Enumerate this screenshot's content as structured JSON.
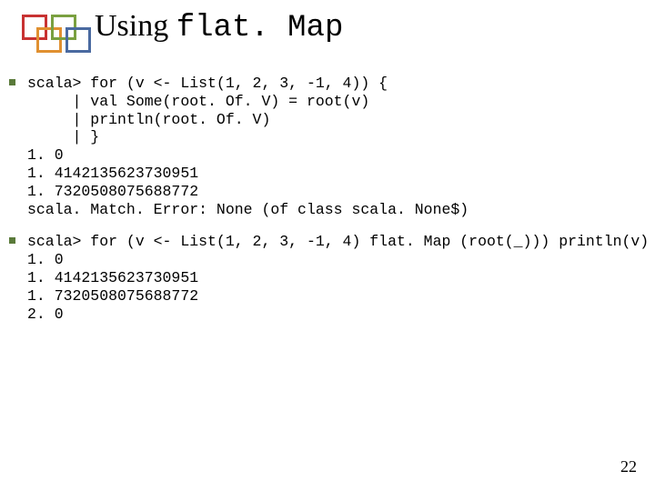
{
  "title": {
    "prefix": "Using ",
    "mono": "flat. Map"
  },
  "blocks": {
    "b1": "scala> for (v <- List(1, 2, 3, -1, 4)) {\n     | val Some(root. Of. V) = root(v)\n     | println(root. Of. V)\n     | }\n1. 0\n1. 4142135623730951\n1. 7320508075688772\nscala. Match. Error: None (of class scala. None$)",
    "b2": "scala> for (v <- List(1, 2, 3, -1, 4) flat. Map (root(_))) println(v)\n1. 0\n1. 4142135623730951\n1. 7320508075688772\n2. 0"
  },
  "page_number": "22"
}
